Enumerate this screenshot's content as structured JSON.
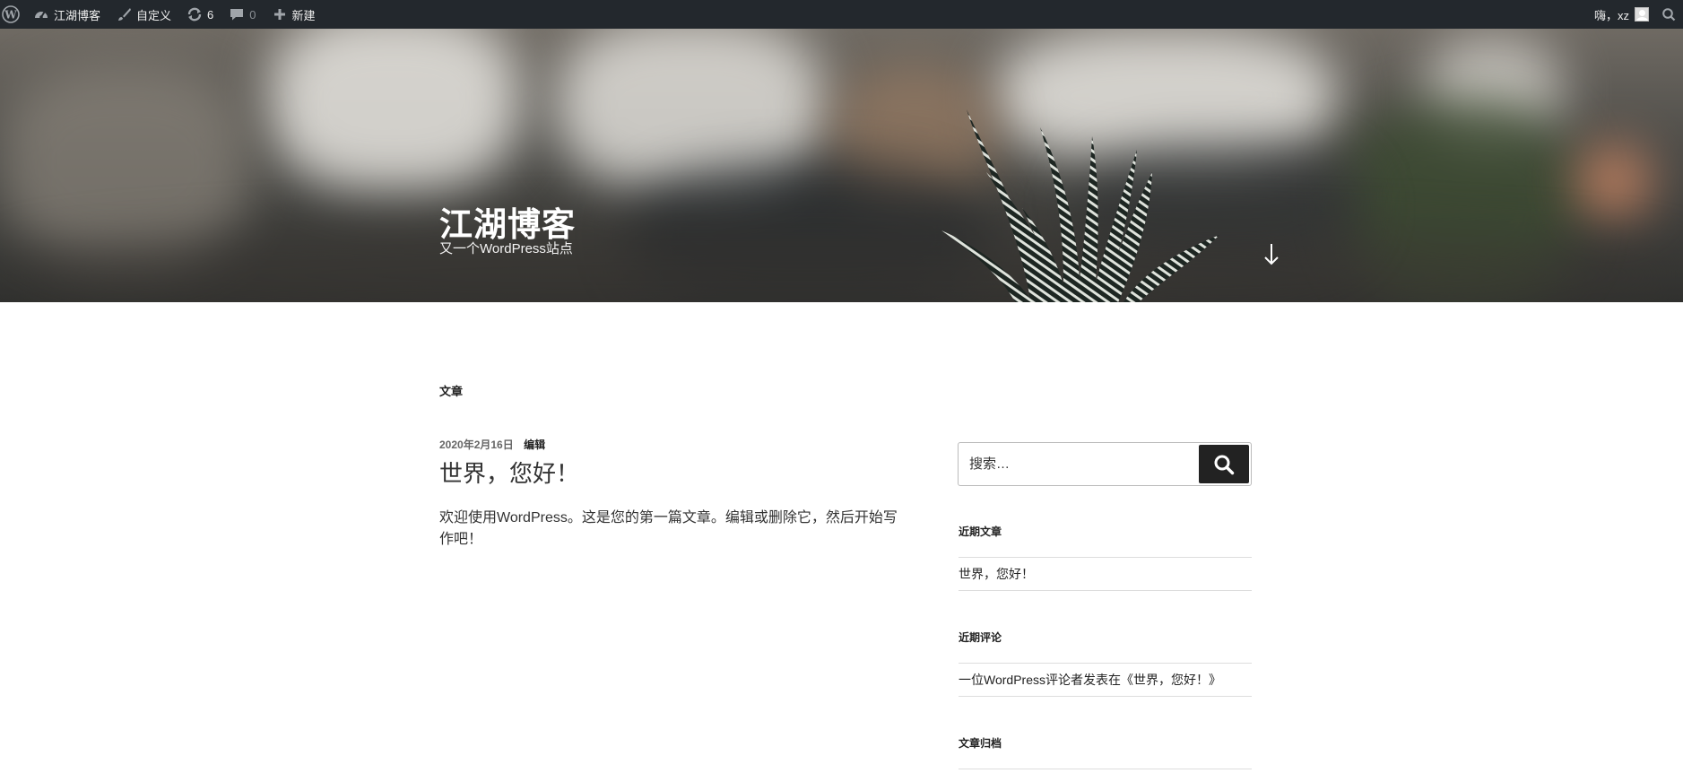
{
  "admin_bar": {
    "site_name": "江湖博客",
    "customize": "自定义",
    "updates": "6",
    "comments": "0",
    "new": "新建",
    "greeting": "嗨，xz"
  },
  "header": {
    "site_title": "江湖博客",
    "tagline": "又一个WordPress站点"
  },
  "main": {
    "section_label": "文章",
    "post": {
      "date": "2020年2月16日",
      "edit": "编辑",
      "title": "世界，您好！",
      "excerpt": "欢迎使用WordPress。这是您的第一篇文章。编辑或删除它，然后开始写作吧！"
    }
  },
  "sidebar": {
    "search_placeholder": "搜索…",
    "recent_posts": {
      "title": "近期文章",
      "items": [
        "世界，您好！"
      ]
    },
    "recent_comments": {
      "title": "近期评论",
      "items": [
        "一位WordPress评论者发表在《世界，您好！》"
      ]
    },
    "archives": {
      "title": "文章归档"
    }
  },
  "colors": {
    "admin_bar_bg": "#23282d",
    "search_button_bg": "#222222"
  }
}
